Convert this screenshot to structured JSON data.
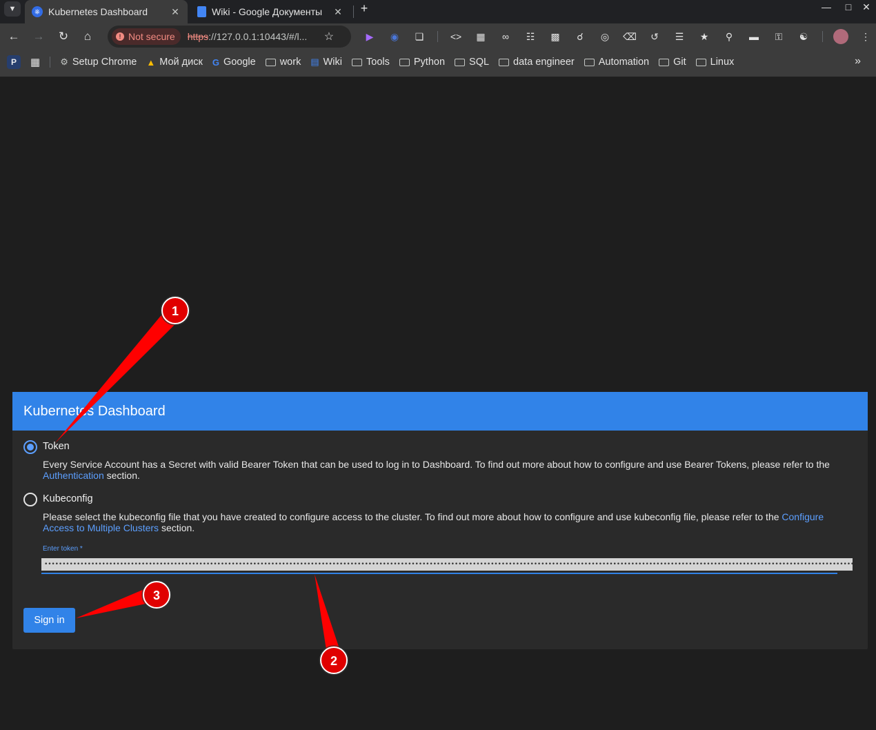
{
  "browser": {
    "tabs": [
      {
        "title": "Kubernetes Dashboard",
        "active": true,
        "icon": "kubernetes-icon"
      },
      {
        "title": "Wiki - Google Документы",
        "active": false,
        "icon": "google-docs-icon"
      }
    ],
    "security_label": "Not secure",
    "url_scheme": "https",
    "url_rest": "://127.0.0.1:10443/#/l...",
    "bookmarks": [
      {
        "label": "Setup Chrome",
        "icon": "gear-icon"
      },
      {
        "label": "Мой диск",
        "icon": "google-drive-icon"
      },
      {
        "label": "Google",
        "icon": "google-icon"
      },
      {
        "label": "work",
        "icon": "folder-icon"
      },
      {
        "label": "Wiki",
        "icon": "google-docs-icon"
      },
      {
        "label": "Tools",
        "icon": "folder-icon"
      },
      {
        "label": "Python",
        "icon": "folder-icon"
      },
      {
        "label": "SQL",
        "icon": "folder-icon"
      },
      {
        "label": "data engineer",
        "icon": "folder-icon"
      },
      {
        "label": "Automation",
        "icon": "folder-icon"
      },
      {
        "label": "Git",
        "icon": "folder-icon"
      },
      {
        "label": "Linux",
        "icon": "folder-icon"
      }
    ],
    "bookmark_p": "P"
  },
  "login": {
    "title": "Kubernetes Dashboard",
    "token_option": {
      "label": "Token",
      "selected": true,
      "desc_before": "Every Service Account has a Secret with valid Bearer Token that can be used to log in to Dashboard. To find out more about how to configure and use Bearer Tokens, please refer to the ",
      "desc_link": "Authentication",
      "desc_after": " section."
    },
    "kubeconfig_option": {
      "label": "Kubeconfig",
      "selected": false,
      "desc_before": "Please select the kubeconfig file that you have created to configure access to the cluster. To find out more about how to configure and use kubeconfig file, please refer to the ",
      "desc_link": "Configure Access to Multiple Clusters",
      "desc_after": " section."
    },
    "token_field_label": "Enter token *",
    "token_value": "••••••••••••••••••••••••••••••••••••••••••••••••••••••••••••••••••••••••••••••••••••••••••••••••••••••••••••••••••••••••••••••••••••••••••••••••••••••••••••••••••••••••••••••••••••••••••••••••••••••••••••••••••••••••••••••••••••••••••••",
    "signin_label": "Sign in"
  },
  "annotations": {
    "markers": [
      "1",
      "2",
      "3"
    ],
    "color": "#ff0000"
  },
  "colors": {
    "accent": "#3183e8",
    "page_bg": "#1e1e1e",
    "card_bg": "#2a2a2a"
  }
}
